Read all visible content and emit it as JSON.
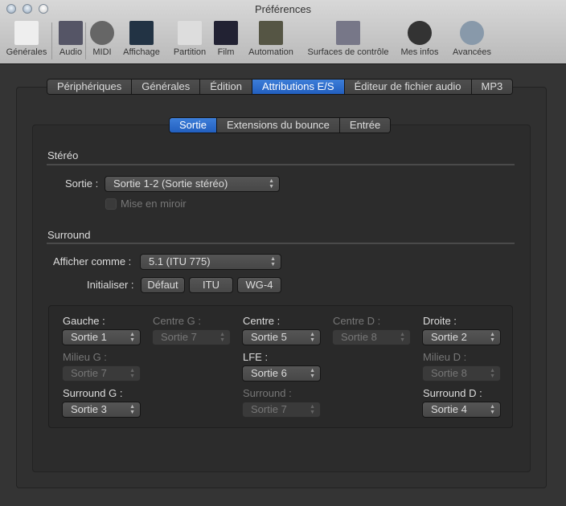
{
  "window": {
    "title": "Préférences"
  },
  "toolbar": [
    {
      "label": "Générales",
      "icon": "switch-icon"
    },
    {
      "label": "Audio",
      "icon": "waveform-icon"
    },
    {
      "label": "MIDI",
      "icon": "midi-connector-icon"
    },
    {
      "label": "Affichage",
      "icon": "monitor-icon"
    },
    {
      "label": "Partition",
      "icon": "music-notes-icon"
    },
    {
      "label": "Film",
      "icon": "clapperboard-icon"
    },
    {
      "label": "Automation",
      "icon": "automation-curve-icon"
    },
    {
      "label": "Surfaces de contrôle",
      "icon": "faders-icon"
    },
    {
      "label": "Mes infos",
      "icon": "person-icon"
    },
    {
      "label": "Avancées",
      "icon": "gear-icon"
    }
  ],
  "tabs": [
    "Périphériques",
    "Générales",
    "Édition",
    "Attributions E/S",
    "Éditeur de fichier audio",
    "MP3"
  ],
  "subtabs": [
    "Sortie",
    "Extensions du bounce",
    "Entrée"
  ],
  "stereo": {
    "title": "Stéréo",
    "output_label": "Sortie :",
    "output_value": "Sortie 1-2 (Sortie stéréo)",
    "mirror_label": "Mise en miroir"
  },
  "surround": {
    "title": "Surround",
    "display_label": "Afficher comme :",
    "display_value": "5.1 (ITU 775)",
    "init_label": "Initialiser :",
    "init_buttons": [
      "Défaut",
      "ITU",
      "WG-4"
    ],
    "channels": [
      {
        "label": "Gauche :",
        "value": "Sortie 1",
        "enabled": true
      },
      {
        "label": "Centre G :",
        "value": "Sortie 7",
        "enabled": false
      },
      {
        "label": "Centre :",
        "value": "Sortie 5",
        "enabled": true
      },
      {
        "label": "Centre D :",
        "value": "Sortie 8",
        "enabled": false
      },
      {
        "label": "Droite :",
        "value": "Sortie 2",
        "enabled": true
      },
      {
        "label": "Milieu G :",
        "value": "Sortie 7",
        "enabled": false
      },
      {
        "label": "LFE :",
        "value": "Sortie 6",
        "enabled": true
      },
      {
        "label": "Milieu D :",
        "value": "Sortie 8",
        "enabled": false
      },
      {
        "label": "Surround G :",
        "value": "Sortie 3",
        "enabled": true
      },
      {
        "label": "Surround :",
        "value": "Sortie 7",
        "enabled": false
      },
      {
        "label": "Surround D :",
        "value": "Sortie 4",
        "enabled": true
      }
    ]
  }
}
